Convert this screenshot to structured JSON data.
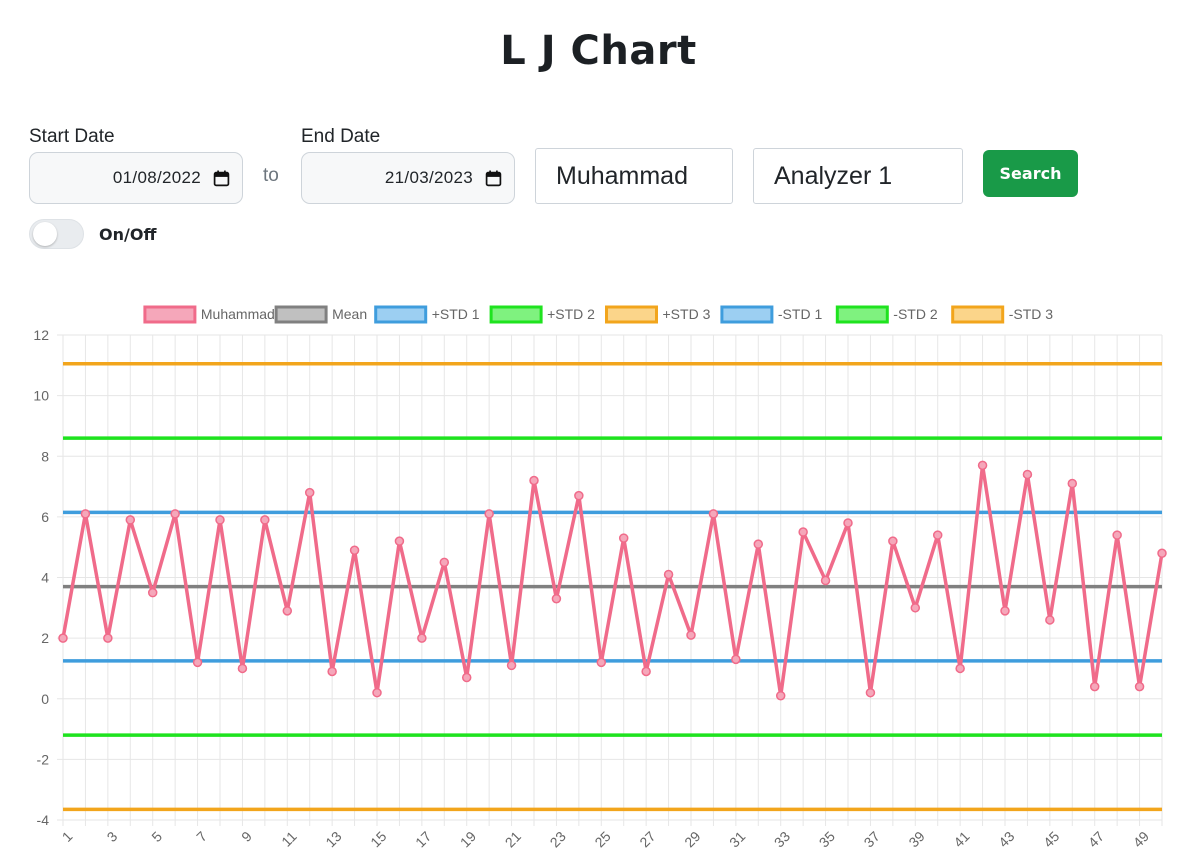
{
  "page": {
    "title": "L J Chart"
  },
  "filters": {
    "start_label": "Start Date",
    "start_value": "01/08/2022",
    "to_text": "to",
    "end_label": "End Date",
    "end_value": "21/03/2023",
    "name_value": "Muhammad",
    "analyzer_value": "Analyzer 1",
    "search_label": "Search",
    "toggle_label": "On/Off",
    "toggle_on": false
  },
  "icons": {
    "date": "calendar-icon"
  },
  "chart_data": {
    "type": "line",
    "legend_position": "top",
    "grid": true,
    "ylim": [
      -4,
      12
    ],
    "yticks": [
      -4,
      -2,
      0,
      2,
      4,
      6,
      8,
      10,
      12
    ],
    "x": [
      1,
      2,
      3,
      4,
      5,
      6,
      7,
      8,
      9,
      10,
      11,
      12,
      13,
      14,
      15,
      16,
      17,
      18,
      19,
      20,
      21,
      22,
      23,
      24,
      25,
      26,
      27,
      28,
      29,
      30,
      31,
      32,
      33,
      34,
      35,
      36,
      37,
      38,
      39,
      40,
      41,
      42,
      43,
      44,
      45,
      46,
      47,
      48,
      49,
      50
    ],
    "xtick_labels": [
      "1",
      "3",
      "5",
      "7",
      "9",
      "11",
      "13",
      "15",
      "17",
      "19",
      "21",
      "23",
      "25",
      "27",
      "29",
      "31",
      "33",
      "35",
      "37",
      "39",
      "41",
      "43",
      "45",
      "47",
      "49"
    ],
    "series": [
      {
        "name": "Muhammad",
        "color": "#f06b8a",
        "fill": "#f5a7ba",
        "values": [
          2.0,
          6.1,
          2.0,
          5.9,
          3.5,
          6.1,
          1.2,
          5.9,
          1.0,
          5.9,
          2.9,
          6.8,
          0.9,
          4.9,
          0.2,
          5.2,
          2.0,
          4.5,
          0.7,
          6.1,
          1.1,
          7.2,
          3.3,
          6.7,
          1.2,
          5.3,
          0.9,
          4.1,
          2.1,
          6.1,
          1.3,
          5.1,
          0.1,
          5.5,
          3.9,
          5.8,
          0.2,
          5.2,
          3.0,
          5.4,
          1.0,
          7.7,
          2.9,
          7.4,
          2.6,
          7.1,
          0.4,
          5.4,
          0.4,
          4.8
        ]
      },
      {
        "name": "Mean",
        "color": "#808080",
        "fill": "#c0c0c0",
        "value": 3.7
      },
      {
        "name": "+STD 1",
        "color": "#3f9ddd",
        "fill": "#9ccff2",
        "value": 6.15
      },
      {
        "name": "+STD 2",
        "color": "#1fe31f",
        "fill": "#7ff27f",
        "value": 8.6
      },
      {
        "name": "+STD 3",
        "color": "#f2a51c",
        "fill": "#fbd58a",
        "value": 11.05
      },
      {
        "name": "-STD 1",
        "color": "#3f9ddd",
        "fill": "#9ccff2",
        "value": 1.25
      },
      {
        "name": "-STD 2",
        "color": "#1fe31f",
        "fill": "#7ff27f",
        "value": -1.2
      },
      {
        "name": "-STD 3",
        "color": "#f2a51c",
        "fill": "#fbd58a",
        "value": -3.65
      }
    ]
  }
}
